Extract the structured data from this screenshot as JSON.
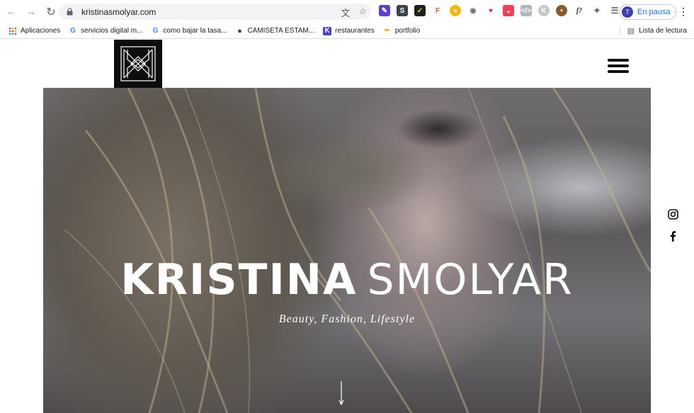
{
  "browser": {
    "url": "kristinasmolyar.com",
    "profile_label": "En pausa",
    "profile_initial": "T",
    "extensions": [
      "pen-icon",
      "s-icon",
      "check-icon",
      "figma-icon",
      "chat-icon",
      "camera-icon",
      "heart-icon",
      "pocket-icon",
      "code-icon",
      "k-icon",
      "cookie-icon",
      "fontfinder-icon",
      "puzzle-icon",
      "playlist-icon"
    ],
    "bookmarks": [
      {
        "label": "Aplicaciones",
        "icon": "apps-grid-icon"
      },
      {
        "label": "servicios digital m...",
        "icon": "google-icon"
      },
      {
        "label": "como bajar la tasa...",
        "icon": "google-icon"
      },
      {
        "label": "CAMISETA ESTAM...",
        "icon": "globe-icon"
      },
      {
        "label": "restaurantes",
        "icon": "k-icon"
      },
      {
        "label": "portfolio",
        "icon": "pen-nib-icon"
      }
    ],
    "reading_list_label": "Lista de lectura"
  },
  "site": {
    "hero": {
      "first_name": "KRISTINA",
      "last_name": "SMOLYAR",
      "tagline": "Beauty, Fashion, Lifestyle"
    },
    "social": [
      "instagram-icon",
      "facebook-icon"
    ]
  }
}
